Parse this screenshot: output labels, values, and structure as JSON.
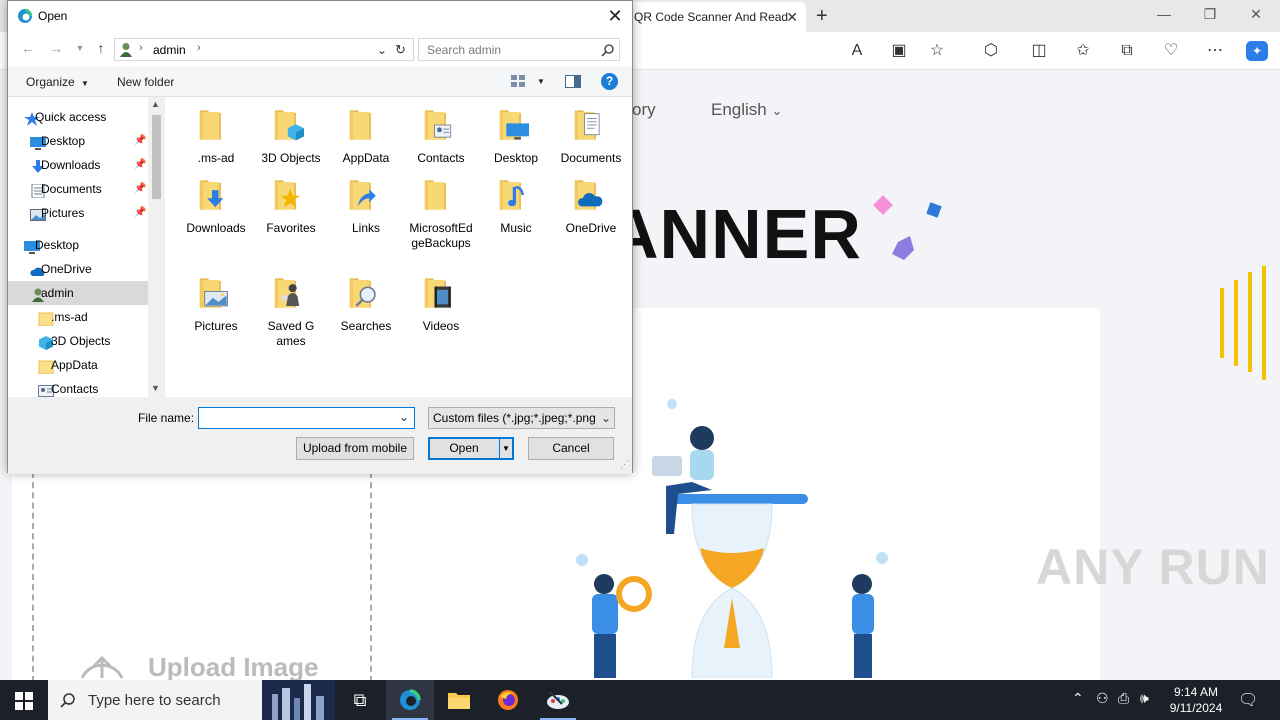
{
  "browser": {
    "tab_title": "QR Code Scanner And Read",
    "tab_close": "✕",
    "new_tab": "+",
    "nav_links": [
      "ory",
      "English"
    ],
    "hero_title": "ANNER",
    "upload_text": "Upload Image",
    "watermark": "ANY RUN"
  },
  "dialog": {
    "title": "Open",
    "close_glyph": "✕",
    "breadcrumb": "admin",
    "search_placeholder": "Search admin",
    "toolbar": {
      "organize": "Organize",
      "new_folder": "New folder",
      "help": "?"
    },
    "nav_pane": [
      {
        "label": "Quick access",
        "icon": "star-icon",
        "pinned": false
      },
      {
        "label": "Desktop",
        "icon": "desktop-icon",
        "pinned": true
      },
      {
        "label": "Downloads",
        "icon": "download-icon",
        "pinned": true
      },
      {
        "label": "Documents",
        "icon": "document-icon",
        "pinned": true
      },
      {
        "label": "Pictures",
        "icon": "picture-icon",
        "pinned": true
      },
      {
        "label": "Desktop",
        "icon": "desktop-icon",
        "pinned": false
      },
      {
        "label": "OneDrive",
        "icon": "cloud-icon",
        "pinned": false
      },
      {
        "label": "admin",
        "icon": "user-icon",
        "pinned": false
      },
      {
        "label": ".ms-ad",
        "icon": "folder-icon",
        "pinned": false
      },
      {
        "label": "3D Objects",
        "icon": "cube-icon",
        "pinned": false
      },
      {
        "label": "AppData",
        "icon": "folder-icon",
        "pinned": false
      },
      {
        "label": "Contacts",
        "icon": "contacts-icon",
        "pinned": false
      }
    ],
    "files": [
      {
        "label": ".ms-ad",
        "badge": ""
      },
      {
        "label": "3D Objects",
        "badge": "cube"
      },
      {
        "label": "AppData",
        "badge": ""
      },
      {
        "label": "Contacts",
        "badge": "contacts"
      },
      {
        "label": "Desktop",
        "badge": "desktop"
      },
      {
        "label": "Documents",
        "badge": "document"
      },
      {
        "label": "Downloads",
        "badge": "download"
      },
      {
        "label": "Favorites",
        "badge": "star"
      },
      {
        "label": "Links",
        "badge": "link"
      },
      {
        "label": "MicrosoftEdgeBackups",
        "badge": ""
      },
      {
        "label": "Music",
        "badge": "music"
      },
      {
        "label": "OneDrive",
        "badge": "cloud"
      },
      {
        "label": "Pictures",
        "badge": "picture"
      },
      {
        "label": "Saved Games",
        "badge": "chess"
      },
      {
        "label": "Searches",
        "badge": "search"
      },
      {
        "label": "Videos",
        "badge": "video"
      }
    ],
    "file_name_label": "File name:",
    "file_name_value": "",
    "file_type": "Custom files (*.jpg;*.jpeg;*.png",
    "upload_mobile": "Upload from mobile",
    "open": "Open",
    "cancel": "Cancel"
  },
  "taskbar": {
    "search_placeholder": "Type here to search",
    "time": "9:14 AM",
    "date": "9/11/2024"
  },
  "colors": {
    "accent": "#0078d7",
    "folder_yellow": "#f8d775",
    "folder_dark": "#e8b84a",
    "taskbar": "#1c2029",
    "hero_orange": "#f5a623"
  }
}
